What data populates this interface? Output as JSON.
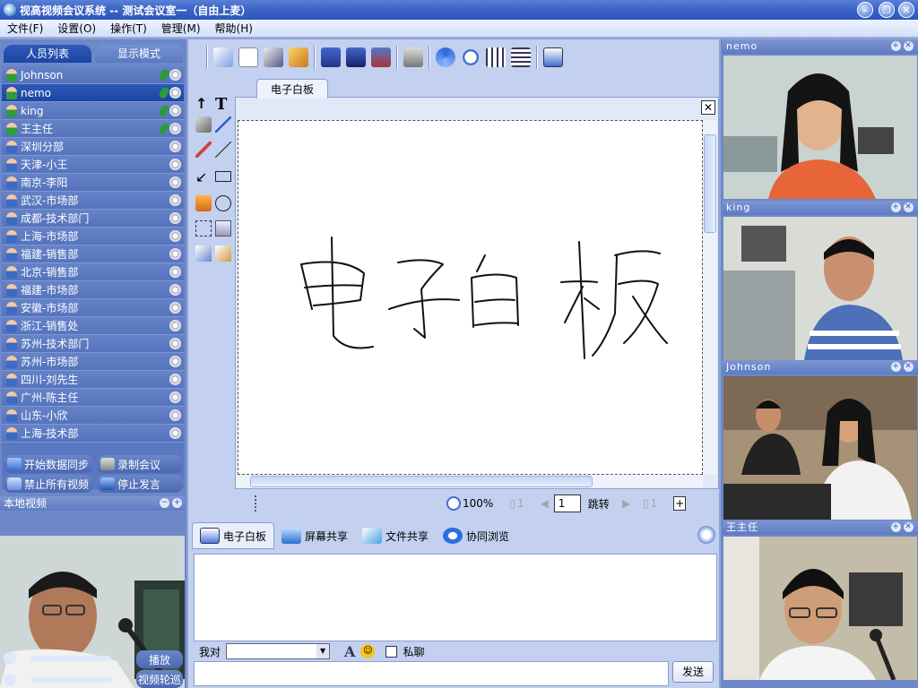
{
  "window": {
    "title": "视高视频会议系统   -- 测试会议室一（自由上麦）"
  },
  "menu": [
    "文件(F)",
    "设置(O)",
    "操作(T)",
    "管理(M)",
    "帮助(H)"
  ],
  "left": {
    "tabs": [
      "人员列表",
      "显示模式"
    ],
    "users": [
      {
        "name": "Johnson",
        "mic": true
      },
      {
        "name": "nemo",
        "mic": true,
        "selected": true
      },
      {
        "name": "king",
        "mic": true
      },
      {
        "name": "王主任",
        "mic": true
      },
      {
        "name": "深圳分部"
      },
      {
        "name": "天津-小王"
      },
      {
        "name": "南京-李阳"
      },
      {
        "name": "武汉-市场部"
      },
      {
        "name": "成都-技术部门"
      },
      {
        "name": "上海-市场部"
      },
      {
        "name": "福建-销售部"
      },
      {
        "name": "北京-销售部"
      },
      {
        "name": "福建-市场部"
      },
      {
        "name": "安徽-市场部"
      },
      {
        "name": "浙江-销售处"
      },
      {
        "name": "苏州-技术部门"
      },
      {
        "name": "苏州-市场部"
      },
      {
        "name": "四川-刘先生"
      },
      {
        "name": "广州-陈主任"
      },
      {
        "name": "山东-小欣"
      },
      {
        "name": "上海-技术部"
      }
    ],
    "buttons": {
      "sync": "开始数据同步",
      "record": "录制会议",
      "stop_video": "禁止所有视频",
      "stop_speak": "停止发言"
    },
    "local_video_title": "本地视频",
    "play": "播放",
    "video_poll": "视频轮巡"
  },
  "center": {
    "wb_tab": "电子白板",
    "handwriting": "电子白板",
    "zoom": "100%",
    "page_before": "1",
    "page_input": "1",
    "goto": "跳转",
    "page_after": "1",
    "tabs": [
      "电子白板",
      "屏幕共享",
      "文件共享",
      "协同浏览"
    ],
    "chat": {
      "to_label": "我对",
      "private": "私聊",
      "send": "发送"
    }
  },
  "videos": [
    {
      "name": "nemo"
    },
    {
      "name": "king"
    },
    {
      "name": "Johnson"
    },
    {
      "name": "王主任"
    }
  ],
  "colors": {
    "frame": "#6d88c9",
    "title_bar": "#3b63c6",
    "selected_row": "#1d46a3"
  }
}
